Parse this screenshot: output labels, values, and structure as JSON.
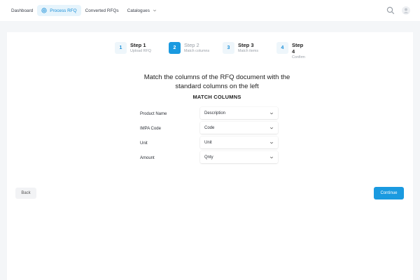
{
  "nav": {
    "items": [
      {
        "label": "Dashboard",
        "icon": "",
        "active": false
      },
      {
        "label": "Process RFQ",
        "icon": "target-icon",
        "active": true
      },
      {
        "label": "Converted RFQs",
        "icon": "",
        "active": false
      },
      {
        "label": "Catalogues",
        "icon": "chevron-down-icon",
        "active": false
      }
    ],
    "right_icons": [
      "search-icon",
      "user-icon"
    ]
  },
  "stepper": {
    "steps": [
      {
        "number": "1",
        "title": "Step 1",
        "subtitle": "Upload RFQ",
        "active": false
      },
      {
        "number": "2",
        "title": "Step 2",
        "subtitle": "Match columns",
        "active": true
      },
      {
        "number": "3",
        "title": "Step 3",
        "subtitle": "Match items",
        "active": false
      },
      {
        "number": "4",
        "title": "Step 4",
        "subtitle": "Confirm",
        "active": false
      }
    ]
  },
  "main": {
    "heading": "Match the columns of the RFQ document with the standard columns on the left",
    "subheading": "MATCH COLUMNS",
    "mappings": [
      {
        "label": "Product Name",
        "value": "Description"
      },
      {
        "label": "IMPA Code",
        "value": "Code"
      },
      {
        "label": "Unit",
        "value": "Unit"
      },
      {
        "label": "Amount",
        "value": "Qnty"
      }
    ]
  },
  "footer": {
    "back_label": "Back",
    "continue_label": "Continue"
  },
  "colors": {
    "accent": "#1a9ae0",
    "active_nav_bg": "#e6f4fc",
    "page_bg": "#f4f6f8"
  }
}
